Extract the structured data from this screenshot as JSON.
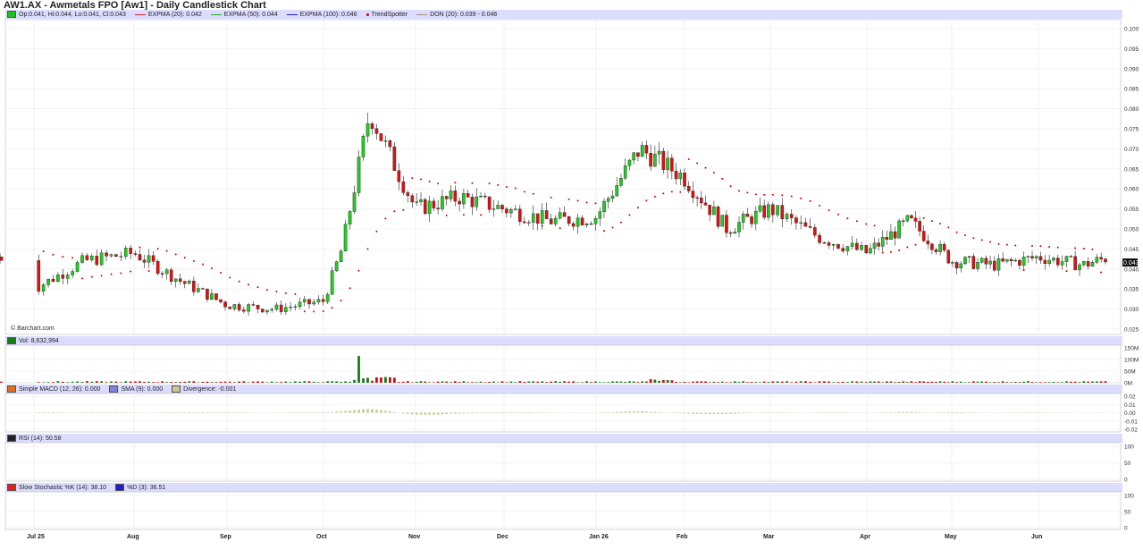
{
  "title": "AW1.AX - Awmetals FPO [Aw1] - Daily Candlestick Chart",
  "watermark": "© Barchart.com",
  "last_price_tag": "0.043",
  "legends": {
    "price": [
      {
        "label": "Op:0.041, Hi:0.044, Lo:0.041, Cl:0.043",
        "kind": "swatch",
        "color": "#22c022"
      },
      {
        "label": "EXPMA (20): 0.042",
        "kind": "line",
        "color": "#e02020"
      },
      {
        "label": "EXPMA (50): 0.044",
        "kind": "line",
        "color": "#20b020"
      },
      {
        "label": "EXPMA (100): 0.046",
        "kind": "line",
        "color": "#2020d0"
      },
      {
        "label": "TrendSpotter",
        "kind": "dot",
        "color": "#cc0000"
      },
      {
        "label": "DON (20): 0.039 - 0.046",
        "kind": "line",
        "color": "#a09070"
      }
    ],
    "volume": [
      {
        "label": "Vol: 8,632,994",
        "kind": "swatch",
        "color": "#1a7a1a"
      }
    ],
    "macd": [
      {
        "label": "Simple MACD (12, 26): 0.000",
        "kind": "swatch",
        "color": "#e07020"
      },
      {
        "label": "SMA (9): 0.000",
        "kind": "swatch",
        "color": "#8080e0"
      },
      {
        "label": "Divergence: -0.001",
        "kind": "swatch",
        "color": "#c8c890"
      }
    ],
    "rsi": [
      {
        "label": "RSI (14): 50.58",
        "kind": "swatch",
        "color": "#222222"
      }
    ],
    "stoch": [
      {
        "label": "Slow Stochastic %K (14): 38.10",
        "kind": "swatch",
        "color": "#e02020"
      },
      {
        "label": "%D (3): 36.51",
        "kind": "swatch",
        "color": "#2020d0"
      }
    ]
  },
  "x_axis_labels": [
    "Jul 25",
    "Aug",
    "Sep",
    "Oct",
    "Nov",
    "Dec",
    "Jan 26",
    "Feb",
    "Mar",
    "Apr",
    "May",
    "Jun"
  ],
  "panes": {
    "price": {
      "ticks": [
        "0.025",
        "0.030",
        "0.035",
        "0.040",
        "0.045",
        "0.050",
        "0.055",
        "0.060",
        "0.065",
        "0.070",
        "0.075",
        "0.080",
        "0.085",
        "0.090",
        "0.095",
        "0.100"
      ]
    },
    "volume": {
      "ticks": [
        "0M",
        "50M",
        "100M",
        "150M"
      ]
    },
    "macd": {
      "ticks": [
        "-0.02",
        "-0.01",
        "0.00",
        "0.01",
        "0.02"
      ]
    },
    "rsi": {
      "ticks": [
        "0",
        "50",
        "100"
      ]
    },
    "stoch": {
      "ticks": [
        "0",
        "50",
        "100"
      ]
    }
  },
  "chart_data": {
    "type": "candlestick",
    "title": "AW1.AX - Awmetals FPO [Aw1] - Daily Candlestick Chart",
    "x_range": [
      "Jul 25",
      "Jun 26"
    ],
    "ylim": [
      0.025,
      0.1
    ],
    "grid": true,
    "legend_position": "top-left",
    "ohlc_last": {
      "open": 0.041,
      "high": 0.044,
      "low": 0.041,
      "close": 0.043
    },
    "close_path": {
      "x_month_index": [
        0,
        0.5,
        1,
        1.5,
        2,
        2.5,
        3,
        3.2,
        3.5,
        4,
        4.5,
        5,
        5.5,
        6,
        6.5,
        7,
        7.5,
        8,
        8.5,
        9,
        9.5,
        10,
        10.5,
        11,
        11.5,
        11.8
      ],
      "close": [
        0.035,
        0.042,
        0.044,
        0.037,
        0.031,
        0.03,
        0.032,
        0.045,
        0.079,
        0.055,
        0.058,
        0.055,
        0.052,
        0.053,
        0.07,
        0.063,
        0.05,
        0.055,
        0.048,
        0.044,
        0.052,
        0.042,
        0.041,
        0.043,
        0.041,
        0.043
      ]
    },
    "indicators": {
      "expma_20": 0.042,
      "expma_50": 0.044,
      "expma_100": 0.046,
      "donchian_20": [
        0.039,
        0.046
      ]
    },
    "volume_last": 8632994,
    "volume_peak_month_index": 3.4,
    "volume_peak": 115000000,
    "macd": {
      "macd": 0.0,
      "signal": 0.0,
      "divergence": -0.001
    },
    "rsi_14": 50.58,
    "stochastic": {
      "k": 38.1,
      "d": 36.51
    }
  }
}
